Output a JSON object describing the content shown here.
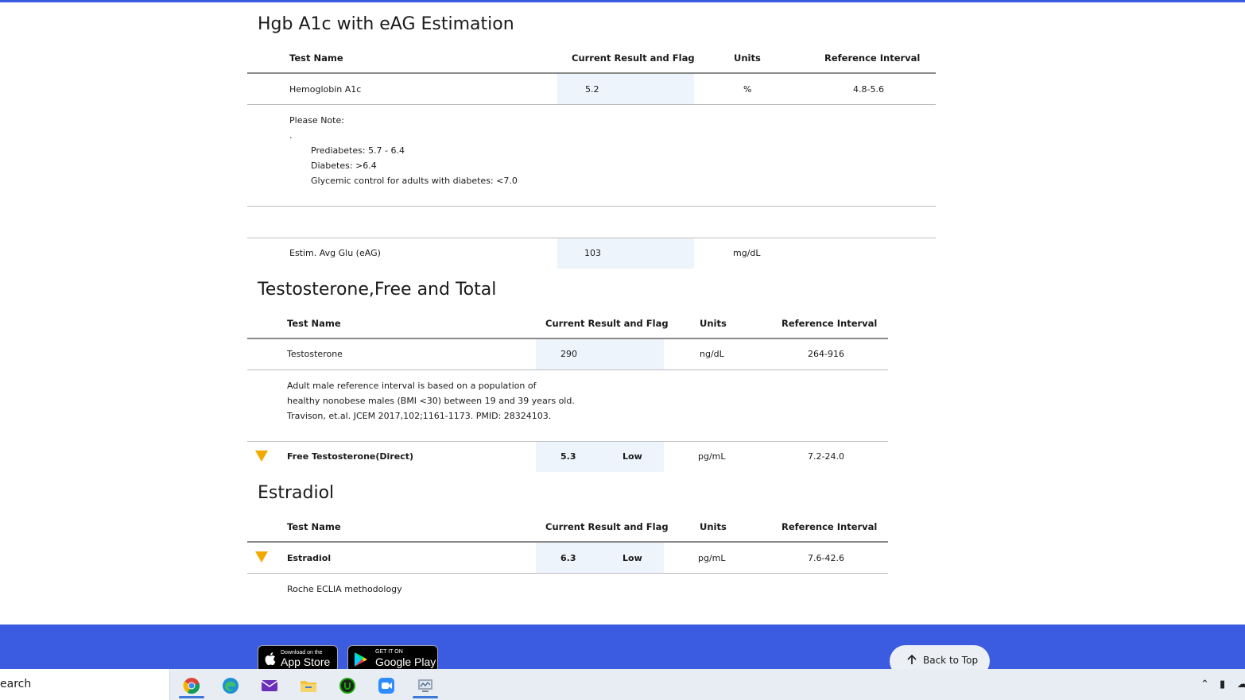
{
  "sections": {
    "hgb": {
      "title": "Hgb A1c with eAG Estimation",
      "headers": {
        "test_name": "Test Name",
        "current_result": "Current Result and Flag",
        "units": "Units",
        "reference_interval": "Reference Interval"
      },
      "row1": {
        "name": "Hemoglobin A1c",
        "result": "5.2",
        "units": "%",
        "reference": "4.8-5.6"
      },
      "note": {
        "title": "Please Note:",
        "dot": ".",
        "lines": [
          "Prediabetes: 5.7 - 6.4",
          "Diabetes: >6.4",
          "Glycemic control for adults with diabetes: <7.0"
        ]
      },
      "row2": {
        "name": "Estim. Avg Glu (eAG)",
        "result": "103",
        "units": "mg/dL",
        "reference": ""
      }
    },
    "testosterone": {
      "title": "Testosterone,Free and Total",
      "headers": {
        "test_name": "Test Name",
        "current_result": "Current Result and Flag",
        "units": "Units",
        "reference_interval": "Reference Interval"
      },
      "row1": {
        "name": "Testosterone",
        "result": "290",
        "units": "ng/dL",
        "reference": "264-916"
      },
      "note": {
        "lines": [
          "Adult male reference interval is based on a population of",
          "healthy nonobese males (BMI <30) between 19 and 39 years old.",
          "Travison, et.al. JCEM 2017,102;1161-1173. PMID: 28324103."
        ]
      },
      "row2": {
        "name": "Free Testosterone(Direct)",
        "result": "5.3",
        "flag": "Low",
        "units": "pg/mL",
        "reference": "7.2-24.0",
        "flag_icon": "low-flag-icon"
      }
    },
    "estradiol": {
      "title": "Estradiol",
      "headers": {
        "test_name": "Test Name",
        "current_result": "Current Result and Flag",
        "units": "Units",
        "reference_interval": "Reference Interval"
      },
      "row1": {
        "name": "Estradiol",
        "result": "6.3",
        "flag": "Low",
        "units": "pg/mL",
        "reference": "7.6-42.6",
        "flag_icon": "low-flag-icon"
      },
      "note": {
        "text": "Roche ECLIA methodology"
      }
    }
  },
  "footer": {
    "app_store": {
      "small": "Download on the",
      "big": "App Store"
    },
    "google_play": {
      "small": "GET IT ON",
      "big": "Google Play"
    },
    "back_to_top": "Back to Top"
  },
  "taskbar": {
    "search_text": "earch",
    "apps": [
      "chrome-icon",
      "edge-icon",
      "mail-icon",
      "file-explorer-icon",
      "upwork-icon",
      "zoom-icon",
      "system-monitor-icon"
    ]
  },
  "colors": {
    "brand_blue": "#3b5be0",
    "result_cell_bg": "#edf4fc",
    "low_flag": "#f2a900"
  }
}
